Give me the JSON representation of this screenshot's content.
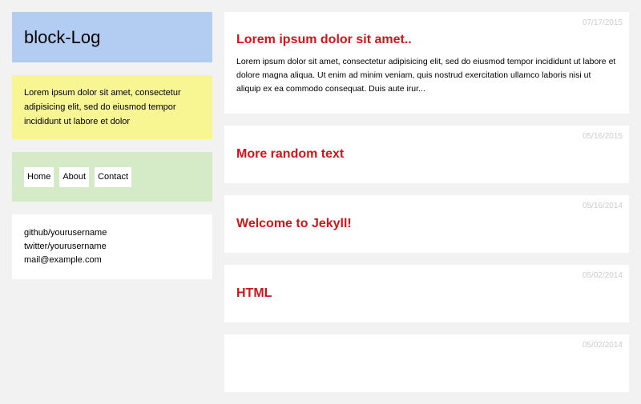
{
  "sidebar": {
    "title": "block-Log",
    "about": "Lorem ipsum dolor sit amet, consectetur adipisicing elit, sed do eiusmod tempor incididunt ut labore et dolor",
    "nav": [
      "Home",
      "About",
      "Contact"
    ],
    "links": [
      "github/yourusername",
      "twitter/yourusername",
      "mail@example.com"
    ]
  },
  "posts": [
    {
      "date": "07/17/2015",
      "title": "Lorem ipsum dolor sit amet..",
      "excerpt": "Lorem ipsum dolor sit amet, consectetur adipisicing elit, sed do eiusmod tempor incididunt ut labore et dolore magna aliqua. Ut enim ad minim veniam, quis nostrud exercitation ullamco laboris nisi ut aliquip ex ea commodo consequat. Duis aute irur..."
    },
    {
      "date": "05/16/2015",
      "title": "More random text"
    },
    {
      "date": "05/16/2014",
      "title": "Welcome to Jekyll!"
    },
    {
      "date": "05/02/2014",
      "title": "HTML"
    },
    {
      "date": "05/02/2014",
      "title": ""
    }
  ],
  "colors": {
    "background": "#f2f2f2",
    "header": "#b3cdf2",
    "about": "#f8f593",
    "nav": "#d5ebc7",
    "post_title": "#d0161a",
    "date": "#cccccc"
  }
}
